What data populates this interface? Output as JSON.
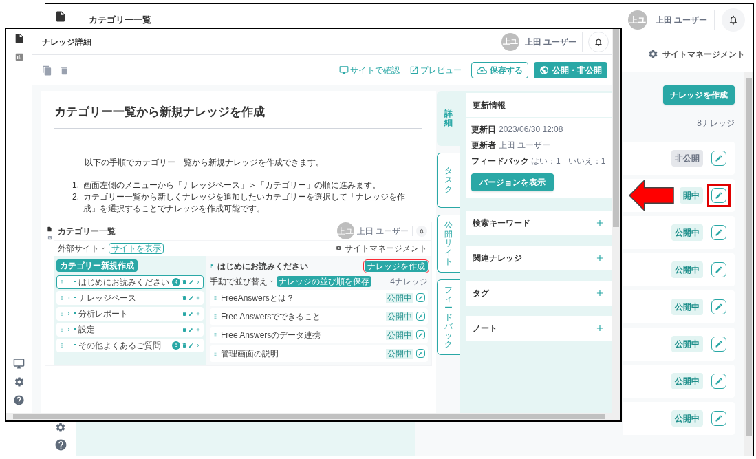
{
  "background_window": {
    "title": "カテゴリー一覧",
    "user": {
      "initials": "上ユ",
      "name": "上田 ユーザー"
    },
    "site_management": "サイトマネージメント",
    "create_button": "ナレッジを作成",
    "count": "8ナレッジ",
    "rows": [
      {
        "status": "非公開",
        "published": false,
        "highlighted": false
      },
      {
        "status": "開中",
        "published": true,
        "highlighted": true
      },
      {
        "status": "公開中",
        "published": true,
        "highlighted": false
      },
      {
        "status": "公開中",
        "published": true,
        "highlighted": false
      },
      {
        "status": "公開中",
        "published": true,
        "highlighted": false
      },
      {
        "status": "公開中",
        "published": true,
        "highlighted": false
      },
      {
        "status": "公開中",
        "published": true,
        "highlighted": false
      },
      {
        "status": "公開中",
        "published": true,
        "highlighted": false
      }
    ]
  },
  "detail_window": {
    "title": "ナレッジ詳細",
    "user": {
      "initials": "上ユ",
      "name": "上田 ユーザー"
    },
    "toolbar": {
      "site_link": "サイトで確認",
      "preview_link": "プレビュー",
      "save_button": "保存する",
      "publish_button": "公開・非公開"
    },
    "article": {
      "heading": "カテゴリー一覧から新規ナレッジを作成",
      "intro": "以下の手順でカテゴリー一覧から新規ナレッジを作成できます。",
      "steps": [
        {
          "number": "1.",
          "text": "画面左側のメニューから「ナレッジベース」＞「カテゴリー」の順に進みます。"
        },
        {
          "number": "2.",
          "text": "カテゴリー一覧から新しくナレッジを追加したいカテゴリーを選択して「ナレッジを作成」を選択することでナレッジを作成可能です。"
        }
      ],
      "screenshot": {
        "title": "カテゴリー一覧",
        "user": {
          "initials": "上ユ",
          "name": "上田 ユーザー"
        },
        "site_select": "外部サイト",
        "view_site": "サイトを表示",
        "site_management": "サイトマネージメント",
        "new_category": "カテゴリー新規作成",
        "categories": [
          {
            "name": "はじめにお読みください",
            "kind": "leaf",
            "count": "4",
            "selected": true
          },
          {
            "name": "ナレッジベース",
            "kind": "folder",
            "selected": false
          },
          {
            "name": "分析レポート",
            "kind": "folder",
            "selected": false
          },
          {
            "name": "設定",
            "kind": "folder",
            "selected": false
          },
          {
            "name": "その他よくあるご質問",
            "kind": "leaf",
            "count": "5",
            "selected": false
          }
        ],
        "panel_title": "はじめにお読みください",
        "create_button": "ナレッジを作成",
        "sort": "手動で並び替え",
        "save_order": "ナレッジの並び順を保存",
        "count": "4ナレッジ",
        "items": [
          {
            "title": "FreeAnswersとは？",
            "status": "公開中"
          },
          {
            "title": "Free Answersでできること",
            "status": "公開中"
          },
          {
            "title": "Free Answersのデータ連携",
            "status": "公開中"
          },
          {
            "title": "管理画面の説明",
            "status": "公開中"
          }
        ]
      }
    },
    "side_tabs": [
      {
        "label": "詳細",
        "selected": true
      },
      {
        "label": "タスク",
        "selected": false
      },
      {
        "label": "公開サイト",
        "selected": false
      },
      {
        "label": "フィードバック",
        "selected": false
      }
    ],
    "update_info": {
      "title": "更新情報",
      "fields": [
        {
          "label": "更新日",
          "value": "2023/06/30 12:08"
        },
        {
          "label": "更新者",
          "value": "上田 ユーザー"
        }
      ],
      "feedback": {
        "label": "フィードバック",
        "yes": "はい：1",
        "no": "いいえ：1"
      },
      "button": "バージョンを表示"
    },
    "sections": [
      "検索キーワード",
      "関連ナレッジ",
      "タグ",
      "ノート"
    ]
  }
}
